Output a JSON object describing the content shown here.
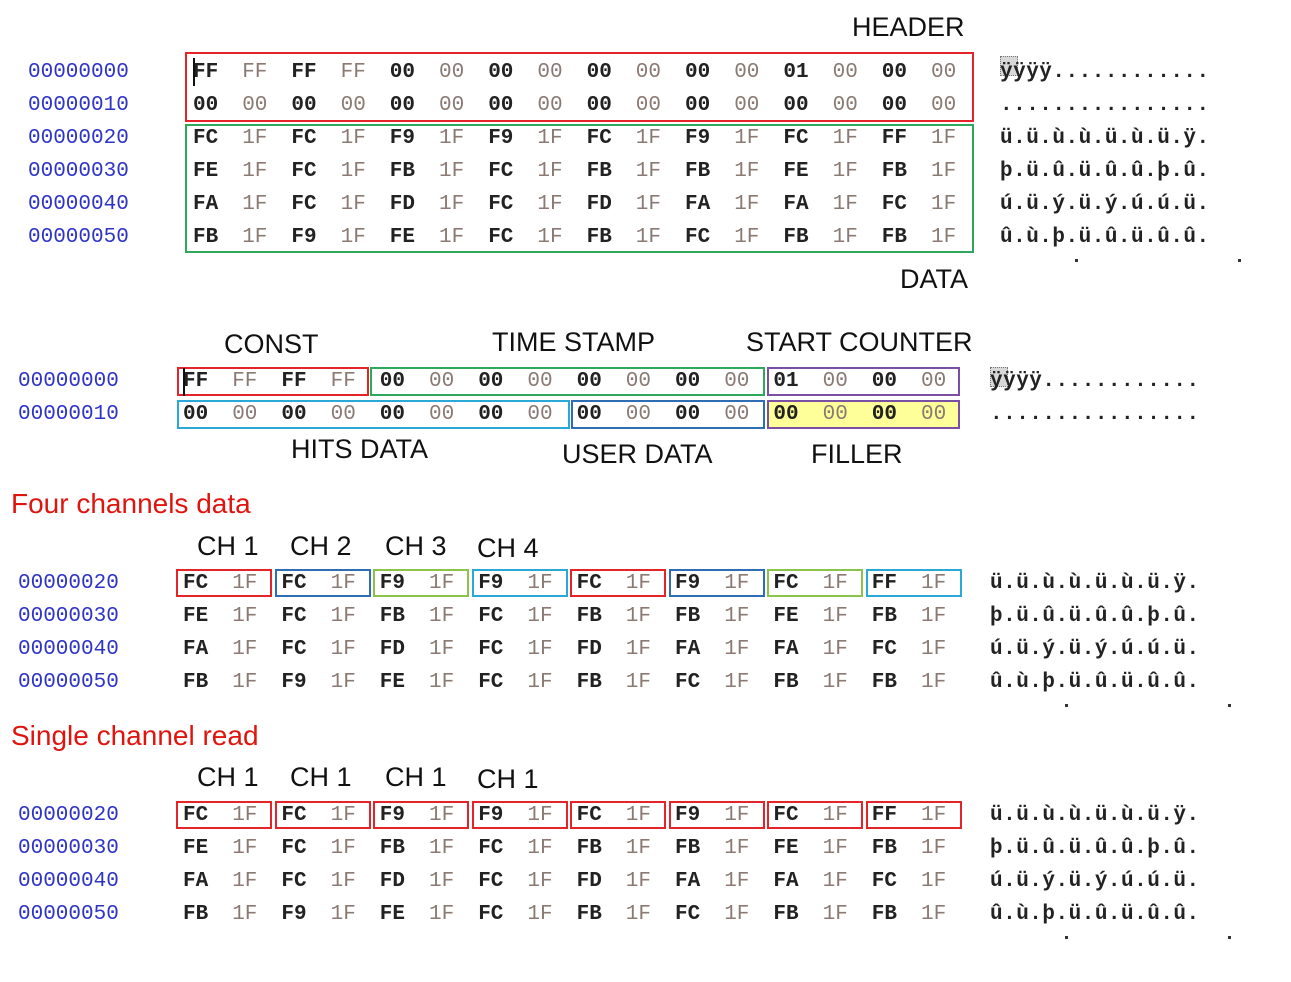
{
  "colors": {
    "address": "#2e34c8",
    "section_title": "#e0140f",
    "red": "#e5242a",
    "green": "#2ea85a",
    "purple": "#7b4fa6",
    "cyan": "#2aa9d8",
    "blue": "#2f6db5",
    "lightgreen": "#8cc34a",
    "filler": "#ffff99"
  },
  "labels": {
    "header": "HEADER",
    "data": "DATA",
    "const": "CONST",
    "time_stamp": "TIME STAMP",
    "start_counter": "START COUNTER",
    "hits_data": "HITS DATA",
    "user_data": "USER DATA",
    "filler": "FILLER",
    "four_channels": "Four channels data",
    "single_channel": "Single channel read",
    "four_ch": [
      "CH 1",
      "CH 2",
      "CH 3",
      "CH 4"
    ],
    "single_ch": [
      "CH 1",
      "CH 1",
      "CH 1",
      "CH 1"
    ]
  },
  "header_rows": [
    {
      "address": "00000000",
      "bytes": [
        "FF",
        "FF",
        "FF",
        "FF",
        "00",
        "00",
        "00",
        "00",
        "00",
        "00",
        "00",
        "00",
        "01",
        "00",
        "00",
        "00"
      ],
      "ascii": "ÿÿÿÿ............"
    },
    {
      "address": "00000010",
      "bytes": [
        "00",
        "00",
        "00",
        "00",
        "00",
        "00",
        "00",
        "00",
        "00",
        "00",
        "00",
        "00",
        "00",
        "00",
        "00",
        "00"
      ],
      "ascii": "................"
    }
  ],
  "data_rows": [
    {
      "address": "00000020",
      "bytes": [
        "FC",
        "1F",
        "FC",
        "1F",
        "F9",
        "1F",
        "F9",
        "1F",
        "FC",
        "1F",
        "F9",
        "1F",
        "FC",
        "1F",
        "FF",
        "1F"
      ],
      "ascii": "ü.ü.ù.ù.ü.ù.ü.ÿ."
    },
    {
      "address": "00000030",
      "bytes": [
        "FE",
        "1F",
        "FC",
        "1F",
        "FB",
        "1F",
        "FC",
        "1F",
        "FB",
        "1F",
        "FB",
        "1F",
        "FE",
        "1F",
        "FB",
        "1F"
      ],
      "ascii": "þ.ü.û.ü.û.û.þ.û."
    },
    {
      "address": "00000040",
      "bytes": [
        "FA",
        "1F",
        "FC",
        "1F",
        "FD",
        "1F",
        "FC",
        "1F",
        "FD",
        "1F",
        "FA",
        "1F",
        "FA",
        "1F",
        "FC",
        "1F"
      ],
      "ascii": "ú.ü.ý.ü.ý.ú.ú.ü."
    },
    {
      "address": "00000050",
      "bytes": [
        "FB",
        "1F",
        "F9",
        "1F",
        "FE",
        "1F",
        "FC",
        "1F",
        "FB",
        "1F",
        "FC",
        "1F",
        "FB",
        "1F",
        "FB",
        "1F"
      ],
      "ascii": "û.ù.þ.ü.û.ü.û.û."
    }
  ]
}
